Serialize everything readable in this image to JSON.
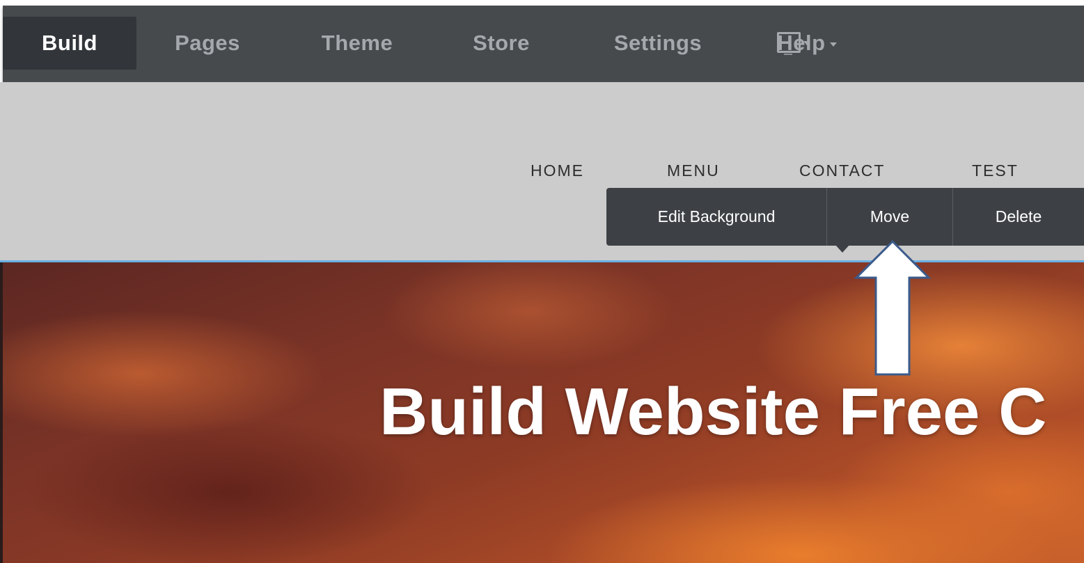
{
  "toolbar": {
    "tabs": [
      {
        "label": "Build",
        "active": true
      },
      {
        "label": "Pages",
        "active": false
      },
      {
        "label": "Theme",
        "active": false
      },
      {
        "label": "Store",
        "active": false
      },
      {
        "label": "Settings",
        "active": false
      },
      {
        "label": "Help",
        "active": false
      }
    ],
    "device_icon": "desktop-monitor-icon"
  },
  "site_nav": {
    "items": [
      "HOME",
      "MENU",
      "CONTACT",
      "TEST"
    ]
  },
  "context_toolbar": {
    "edit_background": "Edit Background",
    "move": "Move",
    "delete": "Delete"
  },
  "hero": {
    "title": "Build Website Free C"
  },
  "annotation": {
    "arrow_icon": "up-arrow-icon"
  },
  "colors": {
    "toolbar_bg": "#464a4d",
    "toolbar_active_bg": "#32363a",
    "header_bg": "#cccccc",
    "context_bar_bg": "#3d4145",
    "selection_line": "#69b0e4",
    "arrow_stroke": "#3b5a8a"
  }
}
